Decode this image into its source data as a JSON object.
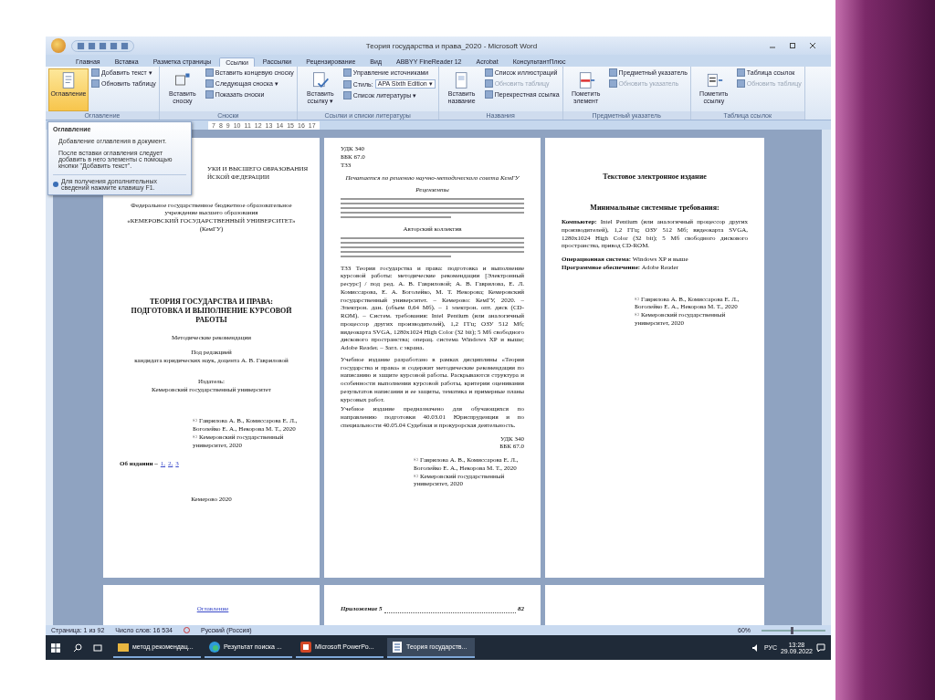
{
  "window": {
    "title": "Теория государства и права_2020 - Microsoft Word"
  },
  "tabs": [
    {
      "label": "Главная",
      "selected": false
    },
    {
      "label": "Вставка",
      "selected": false
    },
    {
      "label": "Разметка страницы",
      "selected": false
    },
    {
      "label": "Ссылки",
      "selected": true
    },
    {
      "label": "Рассылки",
      "selected": false
    },
    {
      "label": "Рецензирование",
      "selected": false
    },
    {
      "label": "Вид",
      "selected": false
    },
    {
      "label": "ABBYY FineReader 12",
      "selected": false
    },
    {
      "label": "Acrobat",
      "selected": false
    },
    {
      "label": "КонсультантПлюс",
      "selected": false
    }
  ],
  "ribbon_groups": [
    {
      "label": "Оглавление",
      "big": {
        "label": "Оглавление",
        "kind": "toc",
        "selected": true
      },
      "small": [
        {
          "label": "Добавить текст ▾",
          "disabled": false
        },
        {
          "label": "Обновить таблицу",
          "disabled": false
        }
      ]
    },
    {
      "label": "Сноски",
      "big": {
        "label": "Вставить сноску",
        "kind": "footnote",
        "selected": false
      },
      "small": [
        {
          "label": "Вставить концевую сноску",
          "disabled": false
        },
        {
          "label": "Следующая сноска ▾",
          "disabled": false
        },
        {
          "label": "Показать сноски",
          "disabled": false
        }
      ]
    },
    {
      "label": "Ссылки и списки литературы",
      "big": {
        "label": "Вставить ссылку ▾",
        "kind": "citation",
        "selected": false
      },
      "small": [
        {
          "label": "Управление источниками",
          "disabled": false
        },
        {
          "label": "Стиль:",
          "disabled": false,
          "dropdown": "APA Sixth Edition ▾"
        },
        {
          "label": "Список литературы ▾",
          "disabled": false
        }
      ]
    },
    {
      "label": "Названия",
      "big": {
        "label": "Вставить название",
        "kind": "caption",
        "selected": false
      },
      "small": [
        {
          "label": "Список иллюстраций",
          "disabled": false
        },
        {
          "label": "Обновить таблицу",
          "disabled": true
        },
        {
          "label": "Перекрестная ссылка",
          "disabled": false
        }
      ]
    },
    {
      "label": "Предметный указатель",
      "big": {
        "label": "Пометить элемент",
        "kind": "mark",
        "selected": false
      },
      "small": [
        {
          "label": "Предметный указатель",
          "disabled": false
        },
        {
          "label": "Обновить указатель",
          "disabled": true
        }
      ]
    },
    {
      "label": "Таблица ссылок",
      "big": {
        "label": "Пометить ссылку",
        "kind": "markcite",
        "selected": false
      },
      "small": [
        {
          "label": "Таблица ссылок",
          "disabled": false
        },
        {
          "label": "Обновить таблицу",
          "disabled": true
        }
      ]
    }
  ],
  "ruler": [
    "7",
    "8",
    "9",
    "10",
    "11",
    "12",
    "13",
    "14",
    "15",
    "16",
    "17"
  ],
  "tooltip": {
    "title": "Оглавление",
    "lines": [
      "Добавление оглавления в документ.",
      "После вставки оглавления следует добавить в него элементы с помощью кнопки \"Добавить текст\"."
    ],
    "help": "Для получения дополнительных сведений нажмите клавишу F1."
  },
  "pages": [
    {
      "blocks": [
        {
          "kind": "cut",
          "text": "УКИ И ВЫСШЕГО ОБРАЗОВАНИЯ"
        },
        {
          "kind": "cut",
          "text": "ЙСКОЙ ФЕДЕРАЦИИ"
        },
        {
          "kind": "center",
          "text": "Федеральное государственное бюджетное образовательное"
        },
        {
          "kind": "center",
          "text": "учреждение высшего образования"
        },
        {
          "kind": "center",
          "text": "«КЕМЕРОВСКИЙ ГОСУДАРСТВЕННЫЙ УНИВЕРСИТЕТ» (КемГУ)"
        },
        {
          "kind": "title",
          "text": "ТЕОРИЯ ГОСУДАРСТВА И ПРАВА:"
        },
        {
          "kind": "title",
          "text": "ПОДГОТОВКА И ВЫПОЛНЕНИЕ КУРСОВОЙ РАБОТЫ"
        },
        {
          "kind": "center",
          "text": "Методические рекомендации"
        },
        {
          "kind": "center",
          "text": "Под редакцией"
        },
        {
          "kind": "center",
          "text": "кандидата юридических наук, доцента А. В. Гавриловой"
        },
        {
          "kind": "center",
          "text": "Издатель:"
        },
        {
          "kind": "center",
          "text": "Кемеровский государственный университет"
        },
        {
          "kind": "copy",
          "text": "© Гаврилова А. В., Комиссарова Е. Л., Боголейко Е. А., Некорова М. Т., 2020"
        },
        {
          "kind": "copy",
          "text": "© Кемеровский государственный университет, 2020"
        },
        {
          "kind": "links",
          "text": "Об издании –",
          "links": [
            "1,",
            "2,",
            "3"
          ]
        },
        {
          "kind": "center",
          "text": "Кемерово 2020"
        }
      ]
    },
    {
      "blocks": [
        {
          "kind": "left",
          "text": "УДК 340"
        },
        {
          "kind": "left",
          "text": "ББК 67.0"
        },
        {
          "kind": "left",
          "text": "Т33"
        },
        {
          "kind": "italic",
          "text": "Печатается по решению научно-методического совета КемГУ"
        },
        {
          "kind": "italic",
          "text": "Рецензенты"
        },
        {
          "kind": "lines"
        },
        {
          "kind": "center",
          "text": "Авторский коллектив"
        },
        {
          "kind": "lines"
        },
        {
          "kind": "para",
          "text": "Т33 Теория государства и права: подготовка и выполнение курсовой работы: методические рекомендации [Электронный ресурс] / под ред. А. В. Гавриловой; А. В. Гаврилова, Е. Л. Комиссарова, Е. А. Боголейко, М. Т. Некорова; Кемеровский государственный университет. – Кемерово: КемГУ, 2020. – Электрон. дан. (объем 0,64 Мб). – 1 электрон. опт. диск (CD-ROM). – Систем. требования: Intel Pentium (или аналогичный процессор других производителей), 1,2 ГГц; ОЗУ 512 Мб; видеокарта SVGA, 1280x1024 High Color (32 bit); 5 Мб свободного дискового пространства; операц. система Windows XP и выше; Adobe Reader. – Загл. с экрана."
        },
        {
          "kind": "para",
          "text": "Учебное издание разработано в рамках дисциплины «Теория государства и права» и содержит методические рекомендации по написанию и защите курсовой работы. Раскрываются структура и особенности выполнения курсовой работы, критерии оценивания результатов написания и ее защиты, тематика и примерные планы курсовых работ."
        },
        {
          "kind": "para",
          "text": "Учебное издание предназначено для обучающихся по направлению подготовки 40.03.01 Юриспруденция и по специальности 40.05.04 Судебная и прокурорская деятельность."
        },
        {
          "kind": "right",
          "text": "УДК 340"
        },
        {
          "kind": "right",
          "text": "ББК 67.0"
        },
        {
          "kind": "copy",
          "text": "© Гаврилова А. В., Комиссарова Е. Л., Боголейко Е. А., Некорова М. Т., 2020"
        },
        {
          "kind": "copy",
          "text": "© Кемеровский государственный университет, 2020"
        }
      ]
    },
    {
      "blocks": [
        {
          "kind": "title",
          "text": "Текстовое электронное издание"
        },
        {
          "kind": "title",
          "text": "Минимальные системные требования:"
        },
        {
          "kind": "para",
          "text": "**Компьютер:** Intel Pentium (или аналогичный процессор других производителей), 1,2 ГГц; ОЗУ 512 Мб; видеокарта SVGA, 1280x1024 High Color (32 bit); 5 Мб свободного дискового пространства, привод CD-ROM."
        },
        {
          "kind": "para",
          "text": "**Операционная система:** Windows XP и выше"
        },
        {
          "kind": "para",
          "text": "**Программное обеспечение:** Adobe Reader"
        },
        {
          "kind": "copy",
          "text": "© Гаврилова А. В., Комиссарова Е. Л., Боголейко Е. А., Некорова М. Т., 2020"
        },
        {
          "kind": "copy",
          "text": "© Кемеровский государственный университет, 2020"
        }
      ]
    }
  ],
  "next_pages": [
    {
      "kind": "link",
      "text": "Оглавление"
    },
    {
      "kind": "toc",
      "text": "Приложение 5",
      "page": "82"
    },
    {
      "kind": "empty"
    }
  ],
  "status_bar": {
    "page": "Страница: 1 из 92",
    "words": "Число слов: 16 534",
    "language": "Русский (Россия)",
    "zoom": "60%",
    "zoom_slider": {
      "level": 0.45
    }
  },
  "taskbar": {
    "apps": [
      {
        "label": "метод рекомендац...",
        "kind": "folder",
        "selected": false
      },
      {
        "label": "Результат поиска ...",
        "kind": "browser",
        "selected": false
      },
      {
        "label": "Microsoft PowerPo...",
        "kind": "powerpoint",
        "selected": false
      },
      {
        "label": "Теория государств...",
        "kind": "word",
        "selected": true
      }
    ],
    "lang": "РУС",
    "time": "13:28",
    "date": "29.09.2022"
  }
}
